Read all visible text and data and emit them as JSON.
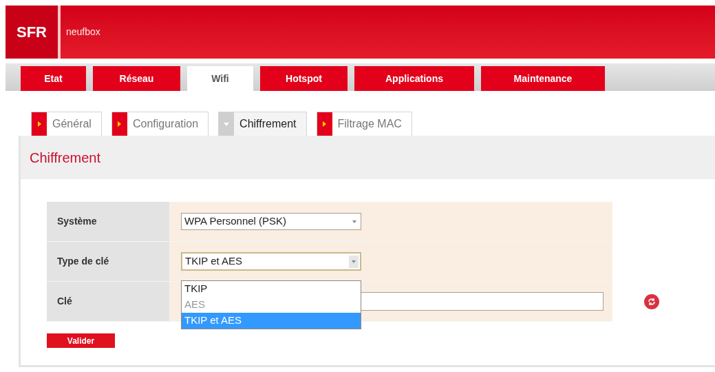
{
  "header": {
    "logo": "SFR",
    "product": "neufbox"
  },
  "main_tabs": [
    {
      "label": "Etat",
      "selected": false
    },
    {
      "label": "Réseau",
      "selected": false
    },
    {
      "label": "Wifi",
      "selected": true
    },
    {
      "label": "Hotspot",
      "selected": false
    },
    {
      "label": "Applications",
      "selected": false
    },
    {
      "label": "Maintenance",
      "selected": false
    }
  ],
  "sub_tabs": [
    {
      "label": "Général",
      "selected": false
    },
    {
      "label": "Configuration",
      "selected": false
    },
    {
      "label": "Chiffrement",
      "selected": true
    },
    {
      "label": "Filtrage MAC",
      "selected": false
    }
  ],
  "panel": {
    "title": "Chiffrement",
    "rows": [
      {
        "kind": "select",
        "label": "Système",
        "value": "WPA Personnel (PSK)"
      },
      {
        "kind": "select",
        "label": "Type de clé",
        "value": "TKIP et AES",
        "expanded": true,
        "options": [
          {
            "label": "TKIP",
            "selected": false,
            "disabled": false
          },
          {
            "label": "AES",
            "selected": false,
            "disabled": true
          },
          {
            "label": "TKIP et AES",
            "selected": true,
            "disabled": false
          }
        ]
      },
      {
        "kind": "input",
        "label": "Clé",
        "value": ""
      }
    ],
    "submit": "Valider"
  }
}
